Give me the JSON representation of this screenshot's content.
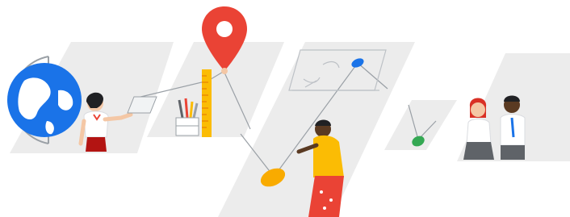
{
  "illustration": {
    "colors": {
      "panel": "#ececec",
      "blue": "#1a73e8",
      "red": "#ea4335",
      "yellow": "#fbbc04",
      "green": "#34a853",
      "skin_light": "#f4c7a5",
      "skin_dark": "#5a3a22",
      "ink": "#202124",
      "line": "#9aa0a6"
    },
    "icons": [
      "globe-icon",
      "map-pin-icon",
      "ruler-icon",
      "pencil-cup-icon",
      "whiteboard-icon"
    ]
  }
}
